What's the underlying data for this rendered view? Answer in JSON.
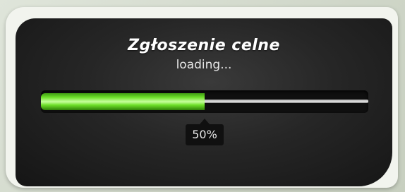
{
  "dialog": {
    "title": "Zgłoszenie celne",
    "status_text": "loading...",
    "progress": {
      "percent": 50,
      "label": "50%"
    }
  },
  "colors": {
    "fill_green": "#6ee02a",
    "panel": "#262626"
  }
}
